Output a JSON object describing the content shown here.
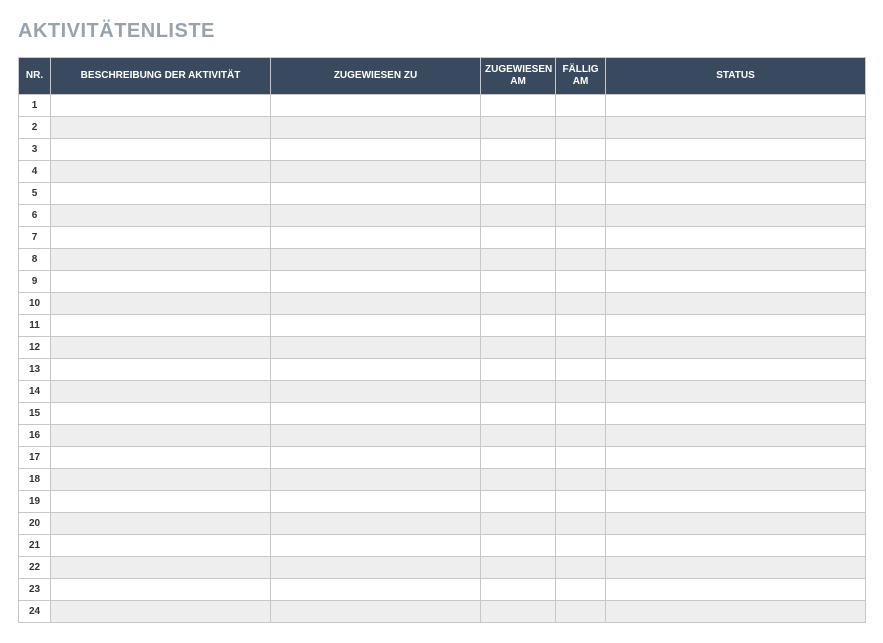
{
  "title": "AKTIVITÄTENLISTE",
  "columns": {
    "nr": "NR.",
    "description": "BESCHREIBUNG DER AKTIVITÄT",
    "assigned_to": "ZUGEWIESEN ZU",
    "assigned_on": "ZUGEWIESEN AM",
    "due_on": "FÄLLIG AM",
    "status": "STATUS"
  },
  "rows": [
    {
      "nr": "1",
      "description": "",
      "assigned_to": "",
      "assigned_on": "",
      "due_on": "",
      "status": ""
    },
    {
      "nr": "2",
      "description": "",
      "assigned_to": "",
      "assigned_on": "",
      "due_on": "",
      "status": ""
    },
    {
      "nr": "3",
      "description": "",
      "assigned_to": "",
      "assigned_on": "",
      "due_on": "",
      "status": ""
    },
    {
      "nr": "4",
      "description": "",
      "assigned_to": "",
      "assigned_on": "",
      "due_on": "",
      "status": ""
    },
    {
      "nr": "5",
      "description": "",
      "assigned_to": "",
      "assigned_on": "",
      "due_on": "",
      "status": ""
    },
    {
      "nr": "6",
      "description": "",
      "assigned_to": "",
      "assigned_on": "",
      "due_on": "",
      "status": ""
    },
    {
      "nr": "7",
      "description": "",
      "assigned_to": "",
      "assigned_on": "",
      "due_on": "",
      "status": ""
    },
    {
      "nr": "8",
      "description": "",
      "assigned_to": "",
      "assigned_on": "",
      "due_on": "",
      "status": ""
    },
    {
      "nr": "9",
      "description": "",
      "assigned_to": "",
      "assigned_on": "",
      "due_on": "",
      "status": ""
    },
    {
      "nr": "10",
      "description": "",
      "assigned_to": "",
      "assigned_on": "",
      "due_on": "",
      "status": ""
    },
    {
      "nr": "11",
      "description": "",
      "assigned_to": "",
      "assigned_on": "",
      "due_on": "",
      "status": ""
    },
    {
      "nr": "12",
      "description": "",
      "assigned_to": "",
      "assigned_on": "",
      "due_on": "",
      "status": ""
    },
    {
      "nr": "13",
      "description": "",
      "assigned_to": "",
      "assigned_on": "",
      "due_on": "",
      "status": ""
    },
    {
      "nr": "14",
      "description": "",
      "assigned_to": "",
      "assigned_on": "",
      "due_on": "",
      "status": ""
    },
    {
      "nr": "15",
      "description": "",
      "assigned_to": "",
      "assigned_on": "",
      "due_on": "",
      "status": ""
    },
    {
      "nr": "16",
      "description": "",
      "assigned_to": "",
      "assigned_on": "",
      "due_on": "",
      "status": ""
    },
    {
      "nr": "17",
      "description": "",
      "assigned_to": "",
      "assigned_on": "",
      "due_on": "",
      "status": ""
    },
    {
      "nr": "18",
      "description": "",
      "assigned_to": "",
      "assigned_on": "",
      "due_on": "",
      "status": ""
    },
    {
      "nr": "19",
      "description": "",
      "assigned_to": "",
      "assigned_on": "",
      "due_on": "",
      "status": ""
    },
    {
      "nr": "20",
      "description": "",
      "assigned_to": "",
      "assigned_on": "",
      "due_on": "",
      "status": ""
    },
    {
      "nr": "21",
      "description": "",
      "assigned_to": "",
      "assigned_on": "",
      "due_on": "",
      "status": ""
    },
    {
      "nr": "22",
      "description": "",
      "assigned_to": "",
      "assigned_on": "",
      "due_on": "",
      "status": ""
    },
    {
      "nr": "23",
      "description": "",
      "assigned_to": "",
      "assigned_on": "",
      "due_on": "",
      "status": ""
    },
    {
      "nr": "24",
      "description": "",
      "assigned_to": "",
      "assigned_on": "",
      "due_on": "",
      "status": ""
    }
  ]
}
